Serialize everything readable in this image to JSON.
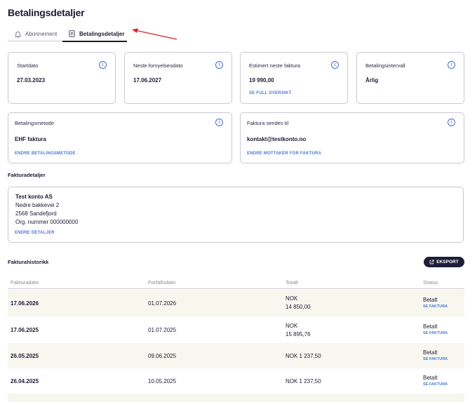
{
  "page": {
    "title": "Betalingsdetaljer"
  },
  "tabs": [
    {
      "label": "Abonnement",
      "active": false
    },
    {
      "label": "Betalingsdetaljer",
      "active": true
    }
  ],
  "summary_cards": [
    {
      "label": "Startdato",
      "value": "27.03.2023",
      "link": ""
    },
    {
      "label": "Neste fornyelsesdato",
      "value": "17.06.2027",
      "link": ""
    },
    {
      "label": "Estimert neste faktura",
      "value": "19 990,00",
      "link": "SE FULL OVERSIKT"
    },
    {
      "label": "Betalingsintervall",
      "value": "Årlig",
      "link": ""
    }
  ],
  "method_cards": [
    {
      "label": "Betalingsmetode",
      "value": "EHF faktura",
      "link": "ENDRE BETALINGSMETODE"
    },
    {
      "label": "Faktura sendes til",
      "value": "kontakt@testkonto.no",
      "link": "ENDRE MOTTAKER FOR FAKTURA"
    }
  ],
  "invoice_details": {
    "title": "Fakturadetaljer",
    "company": "Test konto AS",
    "address": "Nedre bakkevei 2",
    "postal": "2568 Sandefjord",
    "org": "Org. nummer 000000000",
    "link": "ENDRE DETALJER"
  },
  "history": {
    "title": "Fakturahistorikk",
    "export_label": "EKSPORT",
    "columns": [
      "Fakturadato",
      "Forfallsdato",
      "Totalt",
      "Status"
    ],
    "rows": [
      {
        "invoice_date": "17.06.2026",
        "due_date": "01.07.2026",
        "total_line1": "NOK",
        "total_line2": "14 850,00",
        "status": "Betalt",
        "link": "SE FAKTURA"
      },
      {
        "invoice_date": "17.06.2025",
        "due_date": "01.07.2025",
        "total_line1": "NOK",
        "total_line2": "15 895,76",
        "status": "Betalt",
        "link": "SE FAKTURA"
      },
      {
        "invoice_date": "26.05.2025",
        "due_date": "09.06.2025",
        "total_line1": "NOK 1 237,50",
        "total_line2": "",
        "status": "Betalt",
        "link": "SE FAKTURA"
      },
      {
        "invoice_date": "26.04.2025",
        "due_date": "10.05.2025",
        "total_line1": "NOK 1 237,50",
        "total_line2": "",
        "status": "Betalt",
        "link": "SE FAKTURA"
      }
    ]
  },
  "colors": {
    "accent": "#4d7ad1",
    "dark": "#1f1d3a",
    "arrow": "#d9252a",
    "row_alt": "#f7f6ef"
  }
}
